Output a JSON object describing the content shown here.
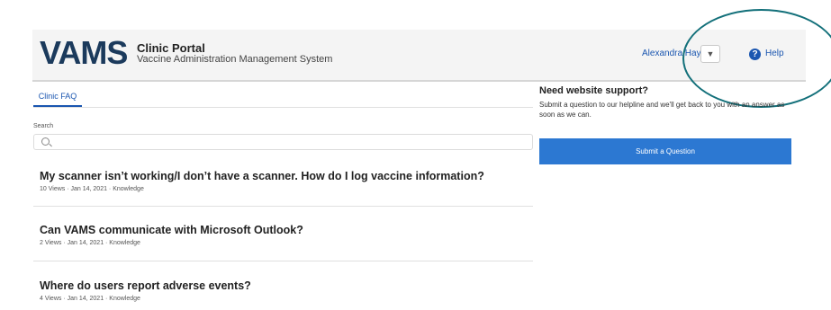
{
  "header": {
    "logo_text": "VAMS",
    "portal_title": "Clinic Portal",
    "portal_subtitle": "Vaccine Administration Management System",
    "user_name": "Alexandra Hayes",
    "dropdown_glyph": "▼",
    "help_glyph": "?",
    "help_label": "Help"
  },
  "tabs": [
    {
      "label": "Clinic FAQ",
      "active": true
    }
  ],
  "search": {
    "label": "Search",
    "placeholder": ""
  },
  "articles": [
    {
      "title": "My scanner isn’t working/I don’t have a scanner. How do I log vaccine information?",
      "meta": "10 Views · Jan 14, 2021 · Knowledge"
    },
    {
      "title": "Can VAMS communicate with Microsoft Outlook?",
      "meta": "2 Views · Jan 14, 2021 · Knowledge"
    },
    {
      "title": "Where do users report adverse events?",
      "meta": "4 Views · Jan 14, 2021 · Knowledge"
    }
  ],
  "support": {
    "title": "Need website support?",
    "text": "Submit a question to our helpline and we'll get back to you with an answer as soon as we can.",
    "button_label": "Submit a Question"
  },
  "colors": {
    "accent": "#2c78d2",
    "link": "#1a56b0",
    "annotation": "#13707a"
  }
}
